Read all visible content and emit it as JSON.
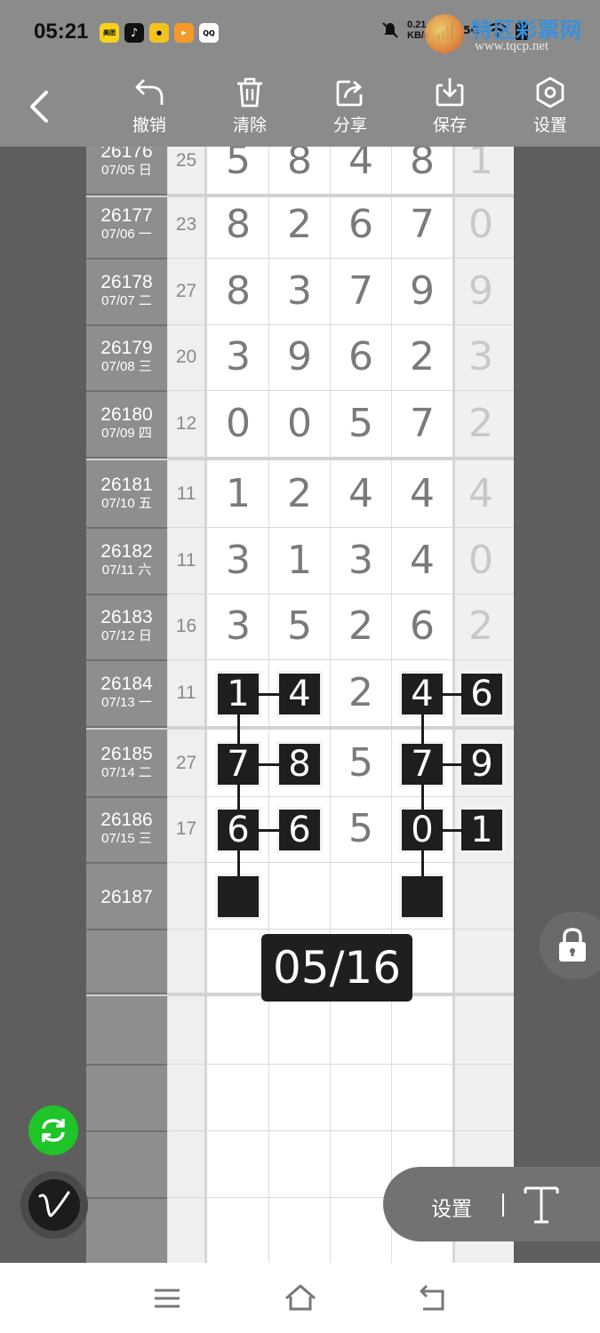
{
  "status": {
    "time": "05:21",
    "apps": [
      "美团",
      "抖音",
      "",
      "",
      "QQ"
    ],
    "net_speed_top": "0.21",
    "net_speed_bottom": "KB/s",
    "signal_text": "5G"
  },
  "watermark": {
    "title": "特区彩票网",
    "url": "www.tqcp.net"
  },
  "toolbar": {
    "undo_label": "撤销",
    "clear_label": "清除",
    "share_label": "分享",
    "save_label": "保存",
    "settings_label": "设置"
  },
  "rows": [
    {
      "issue": "26176",
      "date": "07/05 日",
      "sum": "25",
      "digits": [
        "5",
        "8",
        "4",
        "8"
      ],
      "extra": "1"
    },
    {
      "issue": "26177",
      "date": "07/06 一",
      "sum": "23",
      "digits": [
        "8",
        "2",
        "6",
        "7"
      ],
      "extra": "0"
    },
    {
      "issue": "26178",
      "date": "07/07 二",
      "sum": "27",
      "digits": [
        "8",
        "3",
        "7",
        "9"
      ],
      "extra": "9"
    },
    {
      "issue": "26179",
      "date": "07/08 三",
      "sum": "20",
      "digits": [
        "3",
        "9",
        "6",
        "2"
      ],
      "extra": "3"
    },
    {
      "issue": "26180",
      "date": "07/09 四",
      "sum": "12",
      "digits": [
        "0",
        "0",
        "5",
        "7"
      ],
      "extra": "2"
    },
    {
      "issue": "26181",
      "date": "07/10 五",
      "sum": "11",
      "digits": [
        "1",
        "2",
        "4",
        "4"
      ],
      "extra": "4"
    },
    {
      "issue": "26182",
      "date": "07/11 六",
      "sum": "11",
      "digits": [
        "3",
        "1",
        "3",
        "4"
      ],
      "extra": "0"
    },
    {
      "issue": "26183",
      "date": "07/12 日",
      "sum": "16",
      "digits": [
        "3",
        "5",
        "2",
        "6"
      ],
      "extra": "2"
    },
    {
      "issue": "26184",
      "date": "07/13 一",
      "sum": "11",
      "digits": [
        "1",
        "4",
        "2",
        "4"
      ],
      "extra": "6"
    },
    {
      "issue": "26185",
      "date": "07/14 二",
      "sum": "27",
      "digits": [
        "7",
        "8",
        "5",
        "7"
      ],
      "extra": "9"
    },
    {
      "issue": "26186",
      "date": "07/15 三",
      "sum": "17",
      "digits": [
        "6",
        "6",
        "5",
        "0"
      ],
      "extra": "1"
    },
    {
      "issue": "26187",
      "date": "",
      "sum": "",
      "digits": [
        "",
        "",
        "",
        ""
      ],
      "extra": ""
    }
  ],
  "page_indicator": "05/16",
  "floating": {
    "settings_label": "设置"
  },
  "colors": {
    "refresh": "#1ec428",
    "toolbar_bg": "#8b8b8b",
    "box": "#1e1e1e"
  }
}
